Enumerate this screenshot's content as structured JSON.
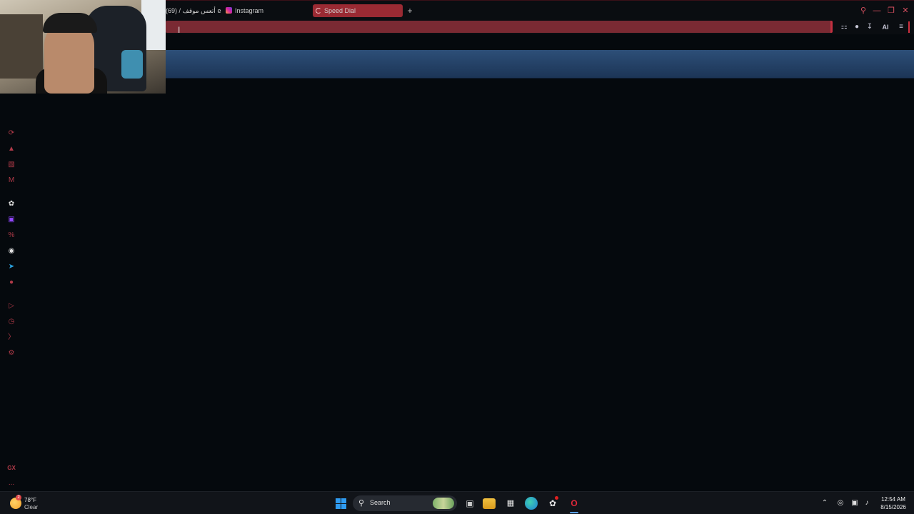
{
  "browser": {
    "tabs": [
      {
        "label": "أتعس موقف / (69) e",
        "icon": "x-icon"
      },
      {
        "label": "Instagram",
        "icon": "instagram-icon"
      },
      {
        "label": "Speed Dial",
        "icon": "loading-icon",
        "active": true
      }
    ],
    "new_tab_label": "+",
    "toolbar": {
      "ai_label": "AI"
    },
    "sidebar_icons": [
      "speed-dial-icon",
      "gx-corner-icon",
      "player-icon",
      "mail-icon",
      "chatgpt-icon",
      "twitch-icon",
      "percent-icon",
      "discord-icon",
      "telegram-icon",
      "record-icon",
      "play-icon",
      "history-icon",
      "pin-icon",
      "settings-icon",
      "gx-icon",
      "more-icon"
    ],
    "sidebar_gx_label": "GX",
    "sidebar_more_label": "...",
    "accent_color": "#c23040",
    "banner_color": "#2d4f78"
  },
  "taskbar": {
    "weather": {
      "temp": "78°F",
      "condition": "Clear",
      "badge": "2"
    },
    "search_placeholder": "Search",
    "clock": {
      "time": "12:54 AM",
      "date": "8/15/2026"
    }
  }
}
